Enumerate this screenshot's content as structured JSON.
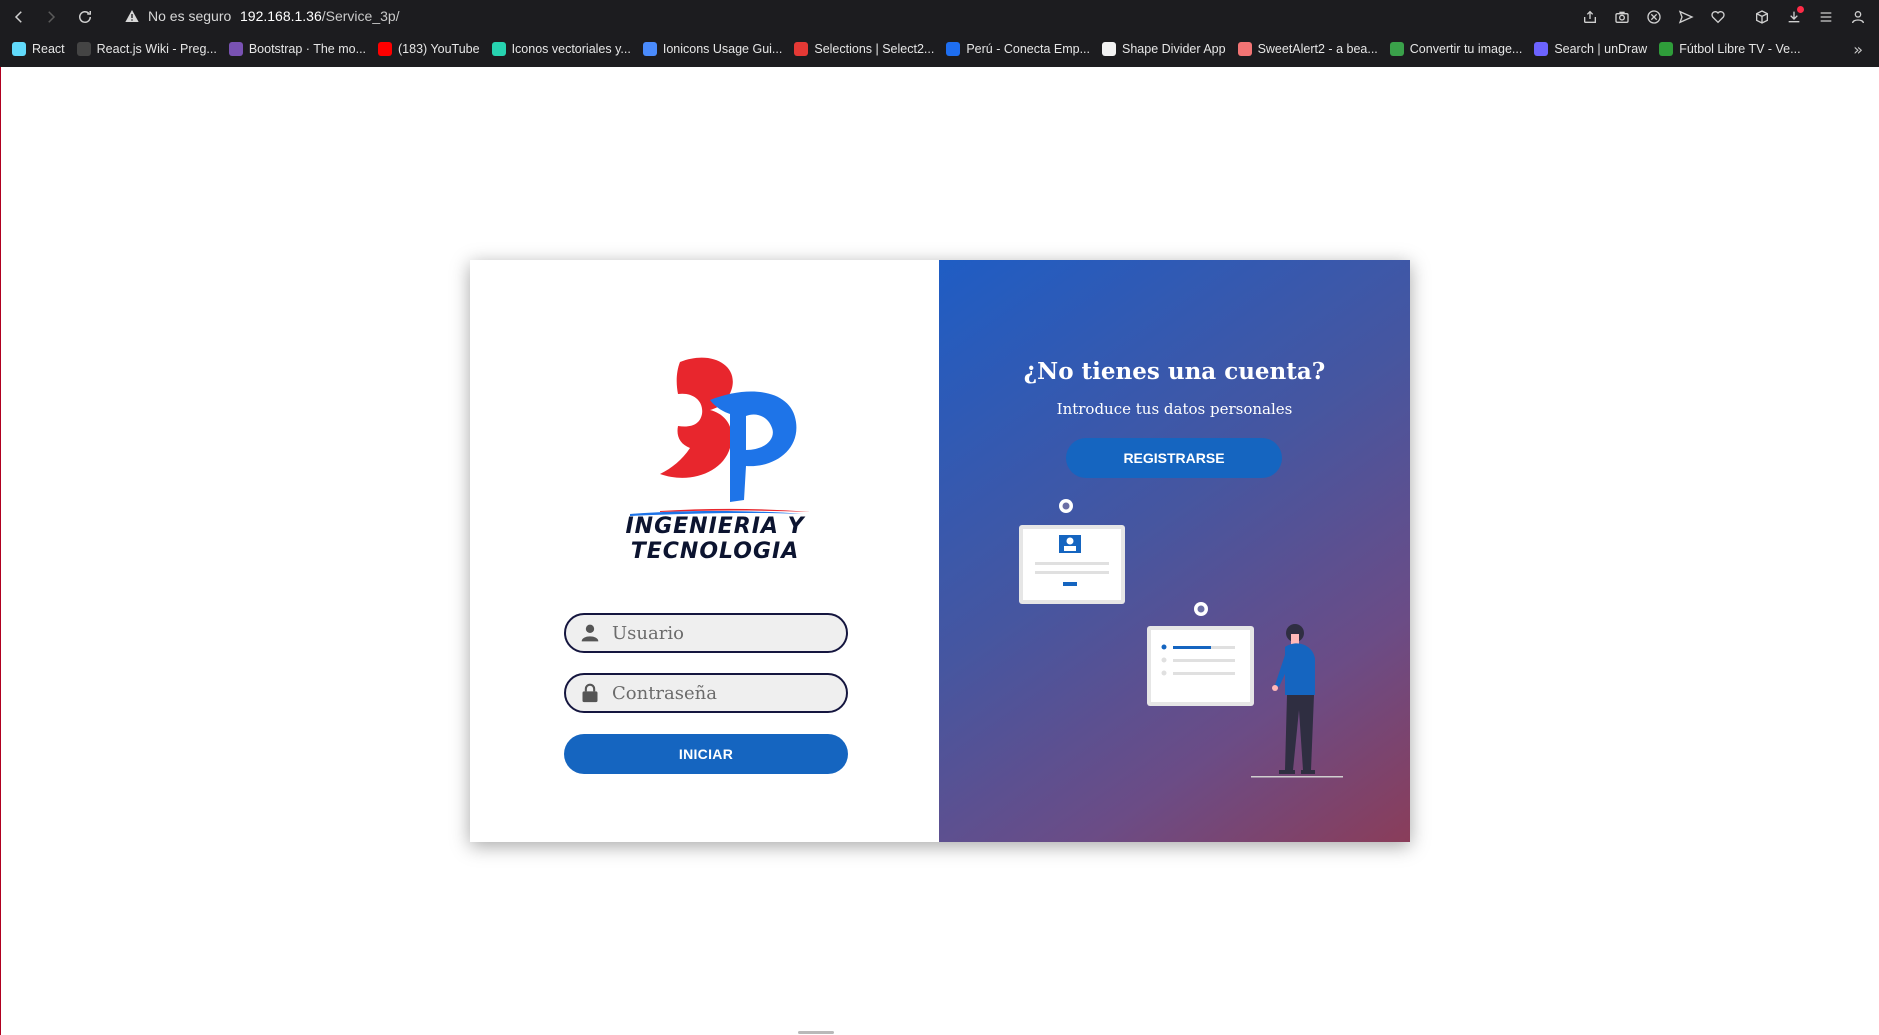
{
  "browser": {
    "security_label": "No es seguro",
    "url_host": "192.168.1.36",
    "url_path": "/Service_3p/",
    "bookmarks": [
      {
        "label": "React",
        "color": "#61dafb"
      },
      {
        "label": "React.js Wiki - Preg...",
        "color": "#444444"
      },
      {
        "label": "Bootstrap · The mo...",
        "color": "#7952b3"
      },
      {
        "label": "(183) YouTube",
        "color": "#ff0000"
      },
      {
        "label": "Iconos vectoriales y...",
        "color": "#27d3b0"
      },
      {
        "label": "Ionicons Usage Gui...",
        "color": "#4a8bfc"
      },
      {
        "label": "Selections | Select2...",
        "color": "#e53935"
      },
      {
        "label": "Perú - Conecta Emp...",
        "color": "#1e6ef0"
      },
      {
        "label": "Shape Divider App",
        "color": "#f2f2f2"
      },
      {
        "label": "SweetAlert2 - a bea...",
        "color": "#f27474"
      },
      {
        "label": "Convertir tu image...",
        "color": "#3aa14a"
      },
      {
        "label": "Search | unDraw",
        "color": "#6c63ff"
      },
      {
        "label": "Fútbol Libre TV - Ve...",
        "color": "#2f9d3a"
      }
    ]
  },
  "login": {
    "brand_text": "INGENIERIA Y TECNOLOGIA",
    "username_placeholder": "Usuario",
    "password_placeholder": "Contraseña",
    "submit_label": "INICIAR"
  },
  "signup": {
    "title": "¿No tienes una cuenta?",
    "subtitle": "Introduce tus datos personales",
    "button_label": "REGISTRARSE"
  },
  "colors": {
    "accent": "#1565c0",
    "logo_red": "#e8262d",
    "logo_blue": "#1e74e8",
    "chrome": "#1c1c1f"
  }
}
